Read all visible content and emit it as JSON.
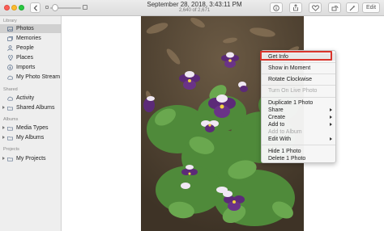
{
  "toolbar": {
    "title": "September 28, 2018, 3:43:11 PM",
    "subtitle": "2,640 of 2,671",
    "edit_label": "Edit"
  },
  "sidebar": {
    "library_header": "Library",
    "library_items": [
      {
        "label": "Photos",
        "icon": "photos-icon",
        "selected": true
      },
      {
        "label": "Memories",
        "icon": "memories-icon"
      },
      {
        "label": "People",
        "icon": "people-icon"
      },
      {
        "label": "Places",
        "icon": "places-icon"
      },
      {
        "label": "Imports",
        "icon": "imports-icon"
      },
      {
        "label": "My Photo Stream",
        "icon": "photo-stream-icon"
      }
    ],
    "shared_header": "Shared",
    "shared_items": [
      {
        "label": "Activity",
        "icon": "activity-icon"
      },
      {
        "label": "Shared Albums",
        "icon": "shared-albums-icon"
      }
    ],
    "albums_header": "Albums",
    "album_items": [
      {
        "label": "Media Types",
        "icon": "folder-icon"
      },
      {
        "label": "My Albums",
        "icon": "folder-icon"
      }
    ],
    "projects_header": "Projects",
    "project_items": [
      {
        "label": "My Projects",
        "icon": "folder-icon"
      }
    ]
  },
  "context_menu": {
    "items": [
      {
        "label": "Get Info"
      },
      {
        "label": "Show in Moment"
      },
      {
        "label": "Rotate Clockwise"
      },
      {
        "label": "Turn On Live Photo",
        "disabled": true
      },
      {
        "label": "Duplicate 1 Photo"
      },
      {
        "label": "Share",
        "submenu": true
      },
      {
        "label": "Create",
        "submenu": true
      },
      {
        "label": "Add to",
        "submenu": true
      },
      {
        "label": "Add to Album",
        "disabled": true
      },
      {
        "label": "Edit With",
        "submenu": true
      },
      {
        "label": "Hide 1 Photo"
      },
      {
        "label": "Delete 1 Photo"
      }
    ]
  },
  "colors": {
    "highlight_border": "#d9342b",
    "sidebar_bg": "#eeeeee",
    "selected_bg": "#d0d0d0"
  }
}
